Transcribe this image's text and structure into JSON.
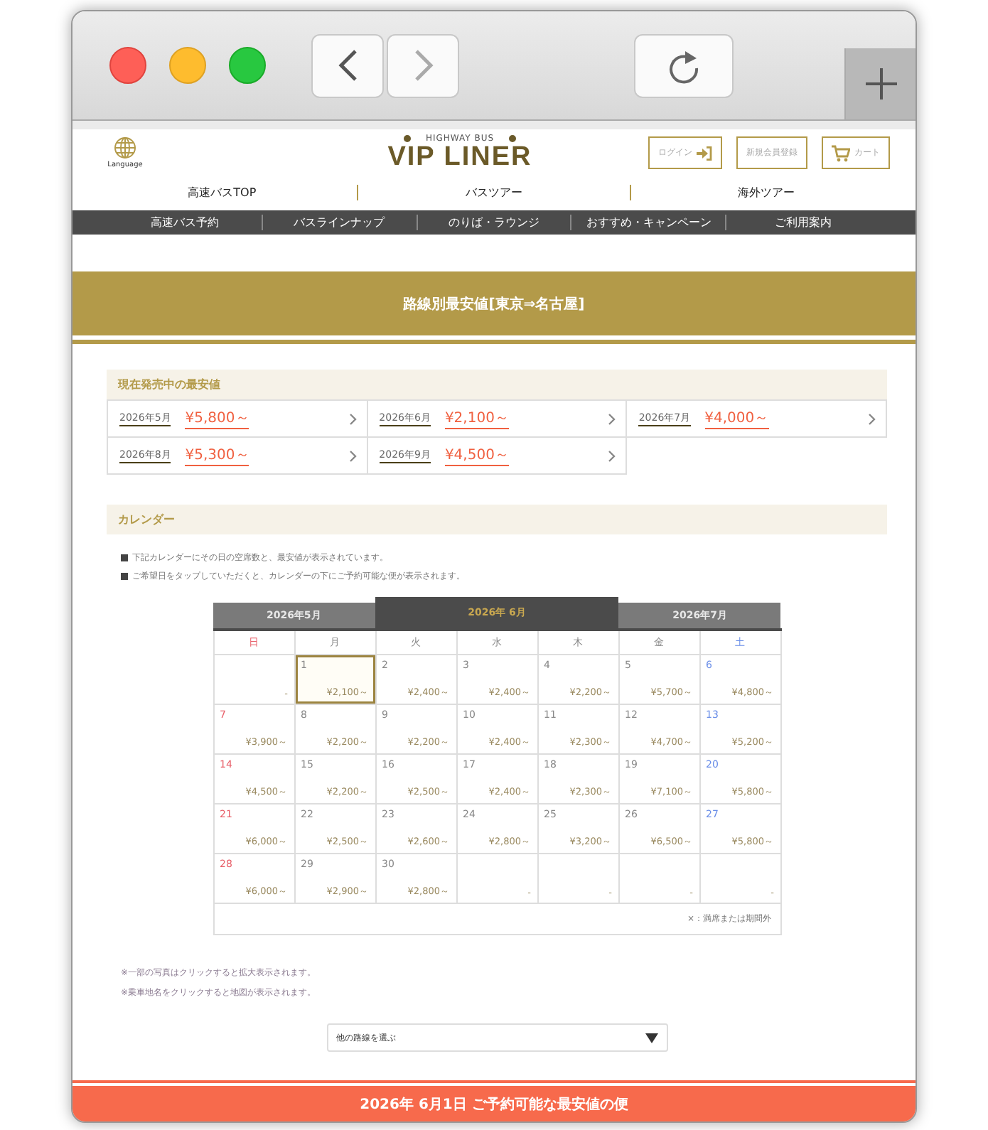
{
  "browser": {
    "back": {
      "disabled": false
    },
    "forward": {
      "disabled": true
    }
  },
  "header": {
    "language": "Language",
    "logo_sub": "HIGHWAY BUS",
    "logo": "VIP LINER",
    "buttons": [
      {
        "label": "ログイン",
        "kind": "login"
      },
      {
        "label": "新規会員登録",
        "kind": "text"
      },
      {
        "label": "カート",
        "kind": "cart"
      }
    ]
  },
  "nav": [
    "高速バスTOP",
    "バスツアー",
    "海外ツアー"
  ],
  "subnav": [
    "高速バス予約",
    "バスラインナップ",
    "のりば・ラウンジ",
    "おすすめ・キャンペーン",
    "ご利用案内"
  ],
  "banner": "路線別最安値[東京⇒名古屋]",
  "lowest": {
    "title": "現在発売中の最安値",
    "items": [
      {
        "month": "2026年5月",
        "price": "¥5,800～"
      },
      {
        "month": "2026年6月",
        "price": "¥2,100～"
      },
      {
        "month": "2026年7月",
        "price": "¥4,000～"
      },
      {
        "month": "2026年8月",
        "price": "¥5,300～"
      },
      {
        "month": "2026年9月",
        "price": "¥4,500～"
      }
    ]
  },
  "calendar": {
    "title": "カレンダー",
    "notes": [
      "下記カレンダーにその日の空席数と、最安値が表示されています。",
      "ご希望日をタップしていただくと、カレンダーの下にご予約可能な便が表示されます。"
    ],
    "months": [
      {
        "label": "2026年5月",
        "selected": false
      },
      {
        "label": "2026年 6月",
        "selected": true
      },
      {
        "label": "2026年7月",
        "selected": false
      }
    ],
    "weekdays": [
      {
        "label": "日",
        "color": "#e8606a"
      },
      {
        "label": "月",
        "color": "#888888"
      },
      {
        "label": "火",
        "color": "#888888"
      },
      {
        "label": "水",
        "color": "#888888"
      },
      {
        "label": "木",
        "color": "#888888"
      },
      {
        "label": "金",
        "color": "#888888"
      },
      {
        "label": "土",
        "color": "#6a8ee8"
      }
    ],
    "weeks": [
      [
        {
          "price": "-",
          "selected": false
        },
        {
          "day": "1",
          "price": "¥2,100～",
          "selected": true
        },
        {
          "day": "2",
          "price": "¥2,400～",
          "selected": false
        },
        {
          "day": "3",
          "price": "¥2,400～",
          "selected": false
        },
        {
          "day": "4",
          "price": "¥2,200～",
          "selected": false
        },
        {
          "day": "5",
          "price": "¥5,700～",
          "selected": false
        },
        {
          "day": "6",
          "price": "¥4,800～",
          "selected": false
        }
      ],
      [
        {
          "day": "7",
          "price": "¥3,900～",
          "selected": false
        },
        {
          "day": "8",
          "price": "¥2,200～",
          "selected": false
        },
        {
          "day": "9",
          "price": "¥2,200～",
          "selected": false
        },
        {
          "day": "10",
          "price": "¥2,400～",
          "selected": false
        },
        {
          "day": "11",
          "price": "¥2,300～",
          "selected": false
        },
        {
          "day": "12",
          "price": "¥4,700～",
          "selected": false
        },
        {
          "day": "13",
          "price": "¥5,200～",
          "selected": false
        }
      ],
      [
        {
          "day": "14",
          "price": "¥4,500～",
          "selected": false
        },
        {
          "day": "15",
          "price": "¥2,200～",
          "selected": false
        },
        {
          "day": "16",
          "price": "¥2,500～",
          "selected": false
        },
        {
          "day": "17",
          "price": "¥2,400～",
          "selected": false
        },
        {
          "day": "18",
          "price": "¥2,300～",
          "selected": false
        },
        {
          "day": "19",
          "price": "¥7,100～",
          "selected": false
        },
        {
          "day": "20",
          "price": "¥5,800～",
          "selected": false
        }
      ],
      [
        {
          "day": "21",
          "price": "¥6,000～",
          "selected": false
        },
        {
          "day": "22",
          "price": "¥2,500～",
          "selected": false
        },
        {
          "day": "23",
          "price": "¥2,600～",
          "selected": false
        },
        {
          "day": "24",
          "price": "¥2,800～",
          "selected": false
        },
        {
          "day": "25",
          "price": "¥3,200～",
          "selected": false
        },
        {
          "day": "26",
          "price": "¥6,500～",
          "selected": false
        },
        {
          "day": "27",
          "price": "¥5,800～",
          "selected": false
        }
      ],
      [
        {
          "day": "28",
          "price": "¥6,000～",
          "selected": false
        },
        {
          "day": "29",
          "price": "¥2,900～",
          "selected": false
        },
        {
          "day": "30",
          "price": "¥2,800～",
          "selected": false
        },
        {
          "price": "-",
          "selected": false
        },
        {
          "price": "-",
          "selected": false
        },
        {
          "price": "-",
          "selected": false
        },
        {
          "price": "-",
          "selected": false
        }
      ]
    ],
    "legend": "×：満席または期間外"
  },
  "footnotes": [
    "※一部の写真はクリックすると拡大表示されます。",
    "※乗車地名をクリックすると地図が表示されます。"
  ],
  "route_select": {
    "value": "他の路線を選ぶ"
  },
  "bottom_banner": "2026年 6月1日 ご予約可能な最安値の便"
}
